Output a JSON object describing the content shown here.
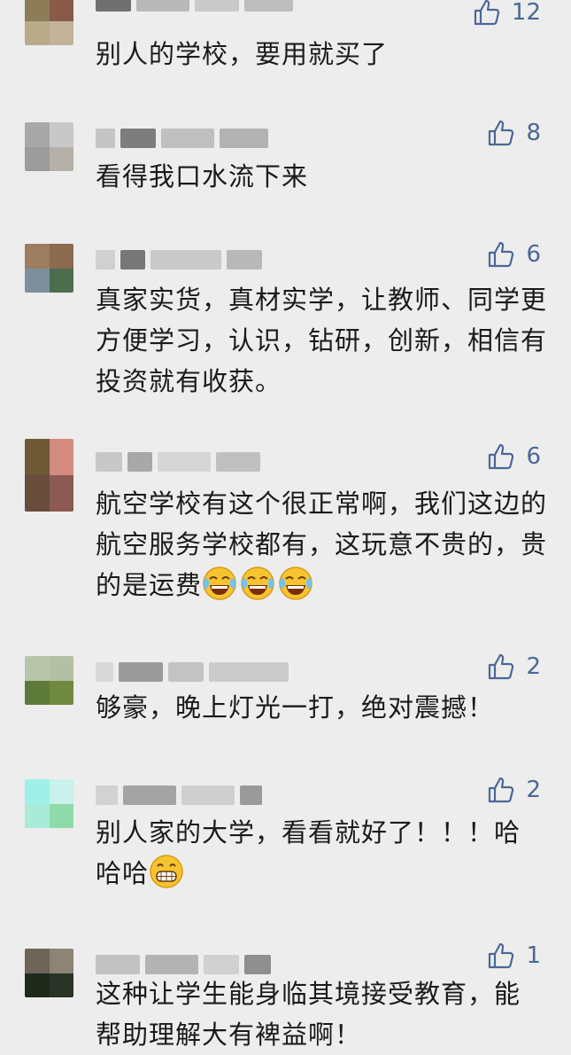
{
  "comments": [
    {
      "likes": "12",
      "text": "别人的学校，要用就买了",
      "avatar": [
        "#8c7c58",
        "#8a5a49",
        "#b7ab8a",
        "#c2b299"
      ],
      "name": [
        "#6f6f6f",
        "#b9b9b9",
        "#c9c9c9",
        "#bdbdbd"
      ]
    },
    {
      "likes": "8",
      "text": "看得我口水流下来",
      "avatar": [
        "#a8a8a8",
        "#c8c8c8",
        "#9c9c9c",
        "#b5b0a8"
      ],
      "name": [
        "#c4c4c4",
        "#7d7d7d",
        "#bfbfbf",
        "#b2b2b2"
      ]
    },
    {
      "likes": "6",
      "text": "真家实货，真材实学，让教师、同学更方便学习，认识，钻研，创新，相信有投资就有收获。",
      "avatar": [
        "#9c7d60",
        "#8c6a4e",
        "#7d8f9c",
        "#4c6d4e"
      ],
      "name": [
        "#d0d0d0",
        "#777777",
        "#c9c9c9",
        "#b8b8b8"
      ]
    },
    {
      "likes": "6",
      "text": "航空学校有这个很正常啊，我们这边的航空服务学校都有，这玩意不贵的，贵的是运费",
      "avatar": [
        "#6d5a35",
        "#d58a7f",
        "#6a4c3d",
        "#8c5a52"
      ],
      "name": [
        "#c7c7c7",
        "#a8a8a8",
        "#d6d6d6",
        "#c0c0c0"
      ],
      "emoji": "laugh-cry",
      "emoji_count": 3
    },
    {
      "likes": "2",
      "text": "够豪，晚上灯光一打，绝对震撼！",
      "avatar": [
        "#b9c4a8",
        "#b4c0a3",
        "#5e7a3a",
        "#6f8a3f"
      ],
      "name": [
        "#d8d8d8",
        "#9b9b9b",
        "#c3c3c3",
        "#cbcbcb"
      ]
    },
    {
      "likes": "2",
      "text": "别人家的大学，看看就好了！！！哈哈哈",
      "avatar": [
        "#9ff0e6",
        "#c8f2ea",
        "#a9ead9",
        "#8edba9"
      ],
      "name": [
        "#d2d2d2",
        "#a4a4a4",
        "#cfcfcf",
        "#9a9a9a"
      ],
      "emoji": "grin",
      "emoji_count": 1
    },
    {
      "likes": "1",
      "text": "这种让学生能身临其境接受教育，能帮助理解大有裨益啊！",
      "avatar": [
        "#6e6458",
        "#8c8474",
        "#1f2a1d",
        "#2a3325"
      ],
      "name": [
        "#c2c2c2",
        "#b3b3b3",
        "#d0d0d0",
        "#8f8f8f"
      ]
    }
  ]
}
